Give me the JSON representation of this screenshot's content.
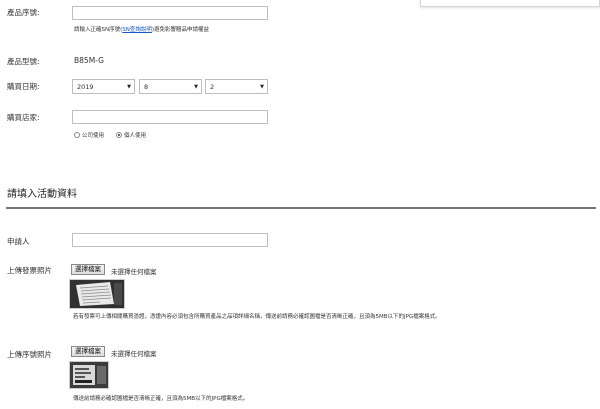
{
  "product": {
    "serial_label": "產品序號:",
    "serial_value": "",
    "serial_hint_before": "請輸入正確SN序號(",
    "serial_hint_link": "SN查詢說明",
    "serial_hint_after": ")避免影響贈品申請權益",
    "model_label": "產品型號:",
    "model_value": "B85M-G",
    "date_label": "購買日期:",
    "date_year": "2019",
    "date_month": "8",
    "date_day": "2",
    "store_label": "購買店家:",
    "store_value": "",
    "radio_company": "公司使用",
    "radio_personal": "個人使用",
    "selected_usage": "personal"
  },
  "activity": {
    "section_title": "請填入活動資料",
    "applicant_label": "申請人",
    "applicant_value": "",
    "invoice_label": "上傳發票照片",
    "invoice_button": "選擇檔案",
    "invoice_status": "未選擇任何檔案",
    "invoice_note": "若有發票可上傳相關購買憑證，憑證內容必須包含所購買產品之品項詳細名稱，傳送前請務必確認圖檔是否清晰正確，且須為5MB以下的JPG檔案格式。",
    "serial_photo_label": "上傳序號照片",
    "serial_photo_button": "選擇檔案",
    "serial_photo_status": "未選擇任何檔案",
    "serial_photo_note": "傳送前請務必確認圖檔是否清晰正確，且須為5MB以下的JPG檔案格式。"
  }
}
